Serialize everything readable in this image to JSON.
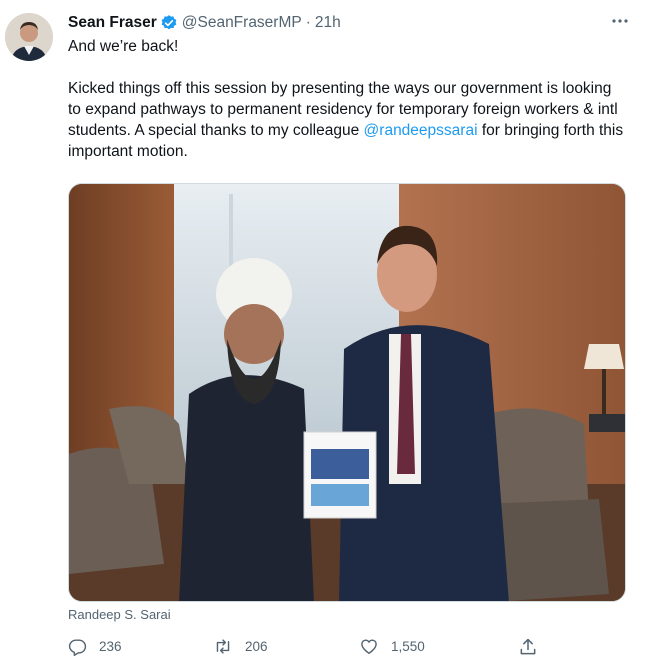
{
  "author": {
    "name": "Sean Fraser",
    "handle": "@SeanFraserMP",
    "separator": "·",
    "time": "21h"
  },
  "tweet": {
    "line1": "And we’re back!",
    "body_before_mention": "Kicked things off this session by presenting the ways our government is looking to expand pathways to permanent residency for temporary foreign workers & intl students. A special thanks to my colleague ",
    "mention": "@randeepssarai",
    "body_after_mention": " for bringing forth this important motion."
  },
  "media": {
    "caption": "Randeep S. Sarai"
  },
  "actions": {
    "replies": "236",
    "retweets": "206",
    "likes": "1,550"
  },
  "icons": {
    "verified": "verified-badge-icon",
    "more": "more-options-icon",
    "reply": "reply-icon",
    "retweet": "retweet-icon",
    "like": "heart-icon",
    "share": "share-icon"
  },
  "colors": {
    "accent": "#1d9bf0",
    "text": "#0f1419",
    "muted": "#536471"
  }
}
